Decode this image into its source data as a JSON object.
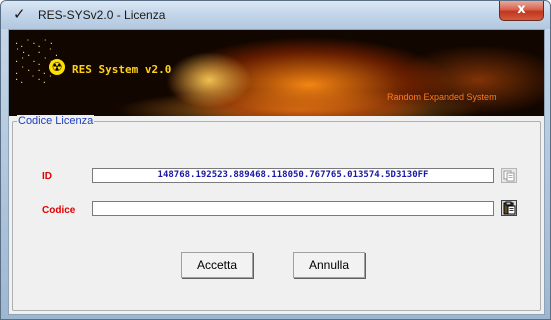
{
  "window": {
    "title": "RES-SYSv2.0 - Licenza",
    "app_icon": "✓",
    "close_label": "x"
  },
  "banner": {
    "title": "RES System v2.0",
    "subtitle": "Random Expanded System"
  },
  "license": {
    "group_label": "Codice Licenza",
    "id_label": "ID",
    "id_value": "148768.192523.889468.118050.767765.013574.5D3130FF",
    "code_label": "Codice",
    "code_value": "",
    "copy_icon": "copy-icon",
    "paste_icon": "paste-icon"
  },
  "buttons": {
    "accept": "Accetta",
    "cancel": "Annulla"
  },
  "colors": {
    "label_red": "#e00000",
    "id_text_blue": "#1717a8",
    "legend_blue": "#1e3fbf",
    "banner_title_yellow": "#ffd21a"
  }
}
